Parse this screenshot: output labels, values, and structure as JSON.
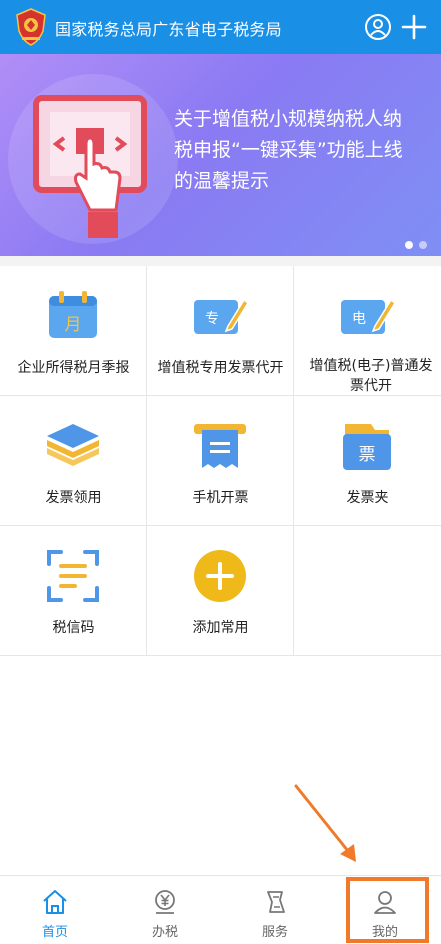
{
  "header": {
    "title": "国家税务总局广东省电子税务局",
    "user_icon": "user-circle-icon",
    "add_icon": "plus-icon"
  },
  "banner": {
    "lines": [
      "关于增值税小规模纳税人纳",
      "税申报“一键采集”功能上线",
      "的温馨提示"
    ],
    "slides": 2,
    "active_slide": 1
  },
  "grid": {
    "items": [
      {
        "label": "企业所得税月季报",
        "icon": "calendar-month-icon"
      },
      {
        "label": "增值税专用发票代开",
        "icon": "special-invoice-pen-icon"
      },
      {
        "label": "增值税(电子)普通发票代开",
        "icon": "electronic-invoice-pen-icon"
      },
      {
        "label": "发票领用",
        "icon": "stacked-layers-icon"
      },
      {
        "label": "手机开票",
        "icon": "invoice-printer-icon"
      },
      {
        "label": "发票夹",
        "icon": "invoice-folder-icon"
      },
      {
        "label": "税信码",
        "icon": "scan-code-icon"
      },
      {
        "label": "添加常用",
        "icon": "add-circle-icon"
      }
    ]
  },
  "bottom_nav": {
    "items": [
      {
        "label": "首页",
        "icon": "home-icon",
        "active": true
      },
      {
        "label": "办税",
        "icon": "yen-coin-icon",
        "active": false
      },
      {
        "label": "服务",
        "icon": "service-icon",
        "active": false
      },
      {
        "label": "我的",
        "icon": "profile-icon",
        "active": false
      }
    ]
  },
  "colors": {
    "brand_blue": "#1a8fe6",
    "annotation_orange": "#f07a2a"
  }
}
